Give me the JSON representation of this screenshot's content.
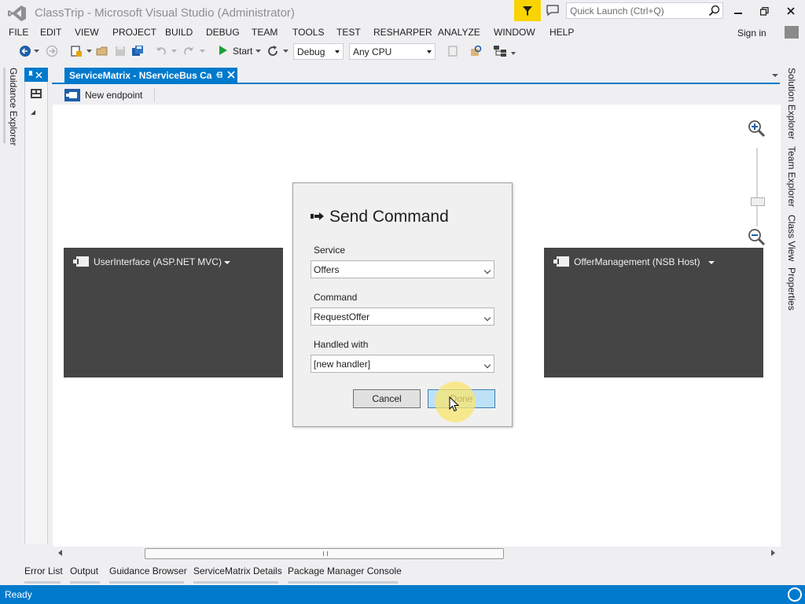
{
  "window": {
    "title": "ClassTrip - Microsoft Visual Studio (Administrator)",
    "quick_launch_placeholder": "Quick Launch (Ctrl+Q)",
    "sign_in": "Sign in"
  },
  "menu": [
    "FILE",
    "EDIT",
    "VIEW",
    "PROJECT",
    "BUILD",
    "DEBUG",
    "TEAM",
    "TOOLS",
    "TEST",
    "RESHARPER",
    "ANALYZE",
    "WINDOW",
    "HELP"
  ],
  "toolbar": {
    "start_label": "Start",
    "config": "Debug",
    "platform": "Any CPU"
  },
  "document": {
    "tab_label": "ServiceMatrix - NServiceBus Ca",
    "new_endpoint": "New endpoint"
  },
  "endpoints": {
    "left": "UserInterface (ASP.NET MVC)",
    "right": "OfferManagement (NSB Host)"
  },
  "dialog": {
    "title": "Send Command",
    "service_label": "Service",
    "service_value": "Offers",
    "command_label": "Command",
    "command_value": "RequestOffer",
    "handled_label": "Handled with",
    "handled_value": "[new handler]",
    "cancel": "Cancel",
    "done": "Done"
  },
  "left_tools": {
    "guidance_explorer": "Guidance Explorer"
  },
  "right_tools": [
    "Solution Explorer",
    "Team Explorer",
    "Class View",
    "Properties"
  ],
  "bottom_tabs": [
    "Error List",
    "Output",
    "Guidance Browser",
    "ServiceMatrix Details",
    "Package Manager Console"
  ],
  "status": {
    "text": "Ready"
  },
  "colors": {
    "accent": "#007acc",
    "notification": "#f9d400",
    "endpoint": "#454545"
  }
}
